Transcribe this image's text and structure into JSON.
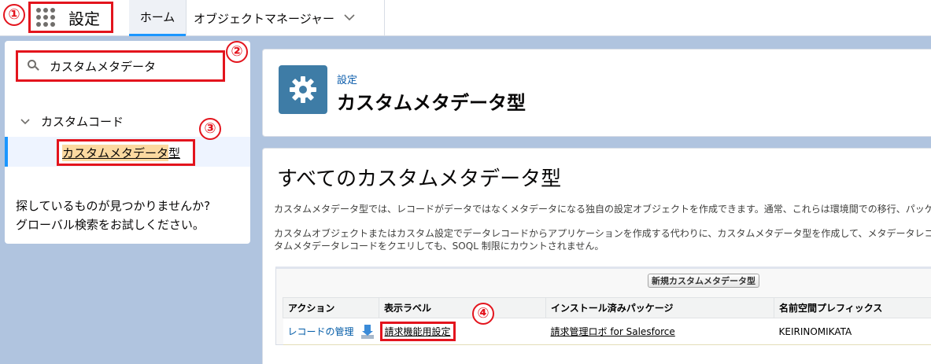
{
  "topnav": {
    "app_name": "設定",
    "home_tab": "ホーム",
    "object_manager_tab": "オブジェクトマネージャー"
  },
  "markers": [
    "①",
    "②",
    "③",
    "④"
  ],
  "sidebar": {
    "search_value": "カスタムメタデータ",
    "tree_parent": "カスタムコード",
    "tree_child_highlight": "カスタムメタデータ",
    "tree_child_suffix": "型",
    "no_results_line1": "探しているものが見つかりませんか?",
    "no_results_line2": "グローバル検索をお試しください。"
  },
  "header": {
    "breadcrumb": "設定",
    "title": "カスタムメタデータ型"
  },
  "main": {
    "title": "すべてのカスタムメタデータ型",
    "desc1": "カスタムメタデータ型では、レコードがデータではなくメタデータになる独自の設定オブジェクトを作成できます。通常、これらは環境間での移行、パッケ",
    "desc2_line1": "カスタムオブジェクトまたはカスタム設定でデータレコードからアプリケーションを作成する代わりに、カスタムメタデータ型を作成して、メタデータレコードを",
    "desc2_line2": "タムメタデータレコードをクエリしても、SOQL 制限にカウントされません。",
    "new_button": "新規カスタムメタデータ型",
    "table": {
      "headers": [
        "アクション",
        "表示ラベル",
        "インストール済みパッケージ",
        "名前空間プレフィックス"
      ],
      "rows": [
        {
          "action": "レコードの管理",
          "label": "請求機能用設定",
          "package": "請求管理ロボ for Salesforce",
          "namespace": "KEIRINOMIKATA"
        }
      ]
    }
  },
  "colors": {
    "annotation_red": "#e3141d",
    "brand_blue": "#1b96ff",
    "gear_tile": "#3e7ca6",
    "background": "#b0c4df"
  }
}
